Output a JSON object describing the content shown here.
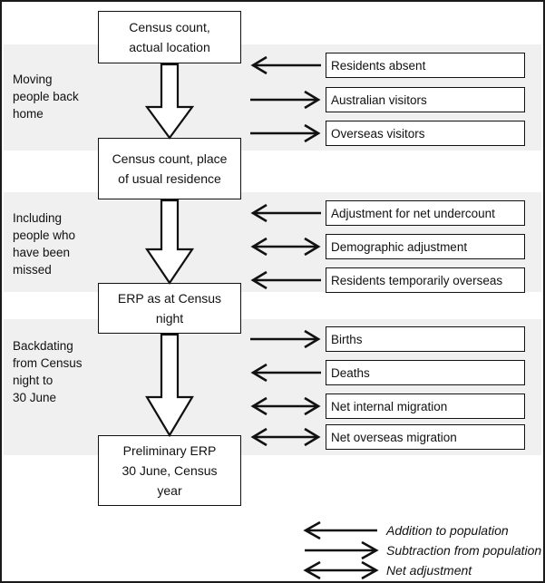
{
  "stages": [
    {
      "id": "moving-people-back-home",
      "label": "Moving\npeople back\nhome"
    },
    {
      "id": "including-people-missed",
      "label": "Including\npeople who\nhave been\nmissed"
    },
    {
      "id": "backdating-to-30-june",
      "label": "Backdating\nfrom Census\nnight to\n30 June"
    }
  ],
  "flow_boxes": [
    {
      "id": "census-count-actual-location",
      "label": "Census count,\nactual location"
    },
    {
      "id": "census-count-usual-residence",
      "label": "Census count, place\nof usual residence"
    },
    {
      "id": "erp-at-census-night",
      "label": "ERP as at Census\nnight"
    },
    {
      "id": "preliminary-erp-30-june",
      "label": "Preliminary ERP\n30 June, Census\nyear"
    }
  ],
  "components": [
    {
      "id": "residents-absent",
      "label": "Residents absent",
      "direction": "left"
    },
    {
      "id": "australian-visitors",
      "label": "Australian visitors",
      "direction": "right"
    },
    {
      "id": "overseas-visitors",
      "label": "Overseas visitors",
      "direction": "right"
    },
    {
      "id": "adjustment-net-undercount",
      "label": "Adjustment for net undercount",
      "direction": "left"
    },
    {
      "id": "demographic-adjustment",
      "label": "Demographic adjustment",
      "direction": "both"
    },
    {
      "id": "residents-temporarily-overseas",
      "label": "Residents temporarily overseas",
      "direction": "left"
    },
    {
      "id": "births",
      "label": "Births",
      "direction": "right"
    },
    {
      "id": "deaths",
      "label": "Deaths",
      "direction": "left"
    },
    {
      "id": "net-internal-migration",
      "label": "Net internal migration",
      "direction": "both"
    },
    {
      "id": "net-overseas-migration",
      "label": "Net overseas migration",
      "direction": "both"
    }
  ],
  "legend": [
    {
      "id": "addition-to-population",
      "label": "Addition to population",
      "direction": "left"
    },
    {
      "id": "subtraction-from-population",
      "label": "Subtraction from population",
      "direction": "right"
    },
    {
      "id": "net-adjustment",
      "label": "Net adjustment",
      "direction": "both"
    }
  ],
  "colors": {
    "band": "#f0f0f0",
    "stroke": "#111111",
    "background": "#ffffff"
  }
}
